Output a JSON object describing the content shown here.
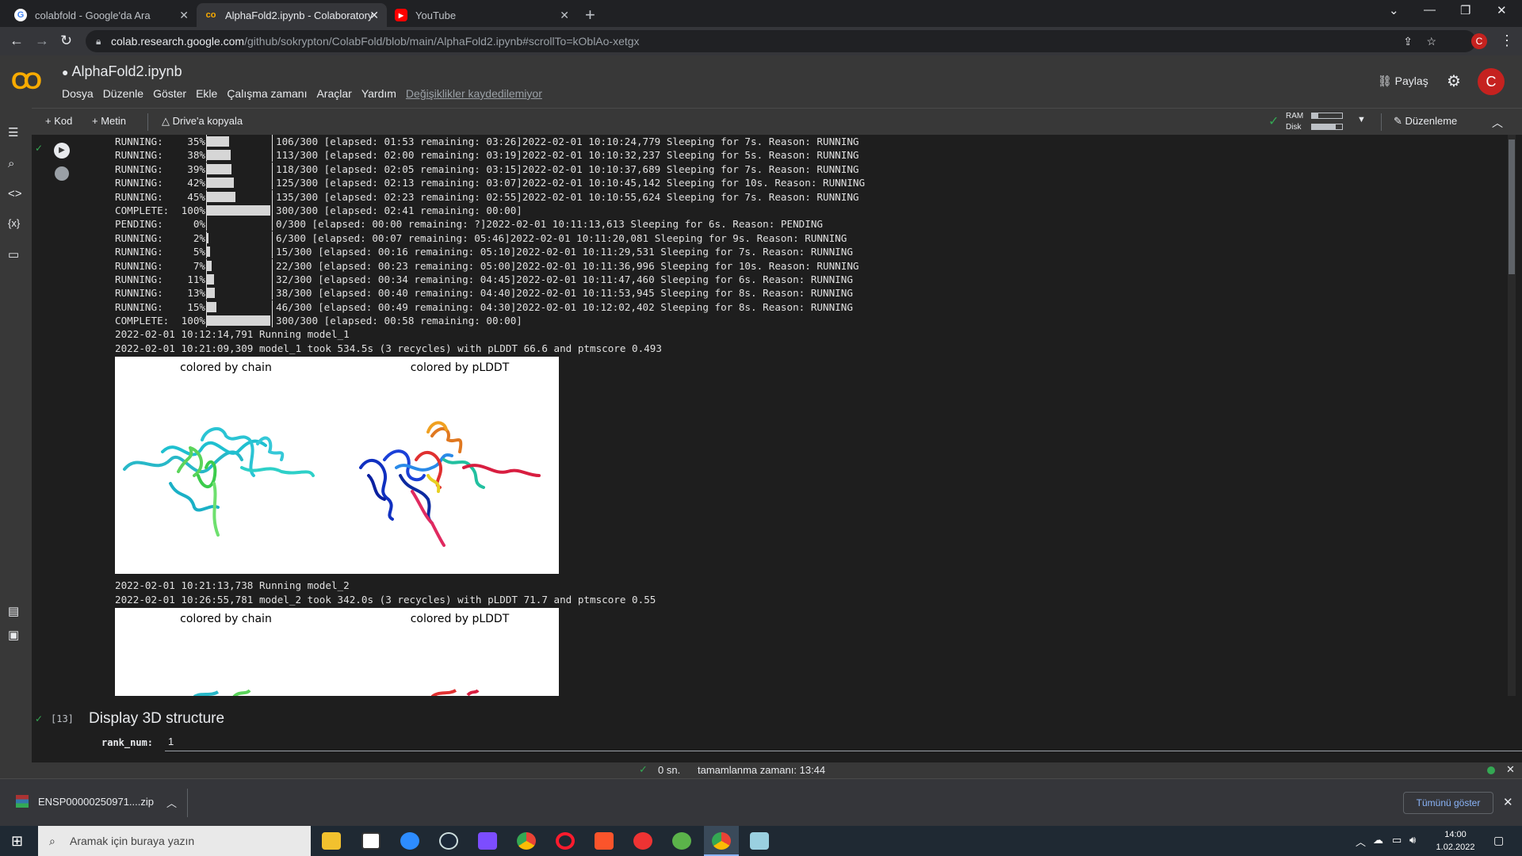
{
  "browser": {
    "tabs": [
      {
        "title": "colabfold - Google'da Ara",
        "icon": "google-icon"
      },
      {
        "title": "AlphaFold2.ipynb - Colaboratory",
        "icon": "colab-icon"
      },
      {
        "title": "YouTube",
        "icon": "youtube-icon"
      }
    ],
    "url_host": "colab.research.google.com",
    "url_path": "/github/sokrypton/ColabFold/blob/main/AlphaFold2.ipynb#scrollTo=kOblAo-xetgx",
    "profile_initial": "C"
  },
  "colab": {
    "notebook_title": "AlphaFold2.ipynb",
    "menu": [
      "Dosya",
      "Düzenle",
      "Göster",
      "Ekle",
      "Çalışma zamanı",
      "Araçlar",
      "Yardım"
    ],
    "unsaved_notice": "Değişiklikler kaydedilemiyor",
    "share_label": "Paylaş",
    "user_initial": "C"
  },
  "toolbar": {
    "add_code": "+ Kod",
    "add_text": "+ Metin",
    "copy_to_drive": "Drive'a kopyala",
    "ram_label": "RAM",
    "disk_label": "Disk",
    "ram_usage": 0.2,
    "disk_usage": 0.8,
    "edit_label": "Düzenleme"
  },
  "output": {
    "log_lines": [
      {
        "status": "RUNNING:",
        "pct": "35%",
        "fill": 0.35,
        "counter": "106/300",
        "rest": "[elapsed: 01:53 remaining: 03:26]2022-02-01 10:10:24,779 Sleeping for 7s. Reason: RUNNING"
      },
      {
        "status": "RUNNING:",
        "pct": "38%",
        "fill": 0.38,
        "counter": "113/300",
        "rest": "[elapsed: 02:00 remaining: 03:19]2022-02-01 10:10:32,237 Sleeping for 5s. Reason: RUNNING"
      },
      {
        "status": "RUNNING:",
        "pct": "39%",
        "fill": 0.39,
        "counter": "118/300",
        "rest": "[elapsed: 02:05 remaining: 03:15]2022-02-01 10:10:37,689 Sleeping for 7s. Reason: RUNNING"
      },
      {
        "status": "RUNNING:",
        "pct": "42%",
        "fill": 0.42,
        "counter": "125/300",
        "rest": "[elapsed: 02:13 remaining: 03:07]2022-02-01 10:10:45,142 Sleeping for 10s. Reason: RUNNING"
      },
      {
        "status": "RUNNING:",
        "pct": "45%",
        "fill": 0.45,
        "counter": "135/300",
        "rest": "[elapsed: 02:23 remaining: 02:55]2022-02-01 10:10:55,624 Sleeping for 7s. Reason: RUNNING"
      },
      {
        "status": "COMPLETE:",
        "pct": "100%",
        "fill": 1.0,
        "counter": "300/300",
        "rest": "[elapsed: 02:41 remaining: 00:00]"
      },
      {
        "status": "PENDING:",
        "pct": "0%",
        "fill": 0.0,
        "counter": "0/300",
        "rest": "[elapsed: 00:00 remaining: ?]2022-02-01 10:11:13,613 Sleeping for 6s. Reason: PENDING"
      },
      {
        "status": "RUNNING:",
        "pct": "2%",
        "fill": 0.02,
        "counter": "6/300",
        "rest": "[elapsed: 00:07 remaining: 05:46]2022-02-01 10:11:20,081 Sleeping for 9s. Reason: RUNNING"
      },
      {
        "status": "RUNNING:",
        "pct": "5%",
        "fill": 0.05,
        "counter": "15/300",
        "rest": "[elapsed: 00:16 remaining: 05:10]2022-02-01 10:11:29,531 Sleeping for 7s. Reason: RUNNING"
      },
      {
        "status": "RUNNING:",
        "pct": "7%",
        "fill": 0.07,
        "counter": "22/300",
        "rest": "[elapsed: 00:23 remaining: 05:00]2022-02-01 10:11:36,996 Sleeping for 10s. Reason: RUNNING"
      },
      {
        "status": "RUNNING:",
        "pct": "11%",
        "fill": 0.11,
        "counter": "32/300",
        "rest": "[elapsed: 00:34 remaining: 04:45]2022-02-01 10:11:47,460 Sleeping for 6s. Reason: RUNNING"
      },
      {
        "status": "RUNNING:",
        "pct": "13%",
        "fill": 0.13,
        "counter": "38/300",
        "rest": "[elapsed: 00:40 remaining: 04:40]2022-02-01 10:11:53,945 Sleeping for 8s. Reason: RUNNING"
      },
      {
        "status": "RUNNING:",
        "pct": "15%",
        "fill": 0.15,
        "counter": "46/300",
        "rest": "[elapsed: 00:49 remaining: 04:30]2022-02-01 10:12:02,402 Sleeping for 8s. Reason: RUNNING"
      },
      {
        "status": "COMPLETE:",
        "pct": "100%",
        "fill": 1.0,
        "counter": "300/300",
        "rest": "[elapsed: 00:58 remaining: 00:00]"
      }
    ],
    "model1_running": "2022-02-01 10:12:14,791 Running model_1",
    "model1_result": "2022-02-01 10:21:09,309 model_1 took 534.5s (3 recycles) with pLDDT 66.6 and ptmscore 0.493",
    "model2_running": "2022-02-01 10:21:13,738 Running model_2",
    "model2_result": "2022-02-01 10:26:55,781 model_2 took 342.0s (3 recycles) with pLDDT 71.7 and ptmscore 0.55",
    "plot_title_chain": "colored by chain",
    "plot_title_plddt": "colored by pLDDT"
  },
  "next_cell": {
    "exec_count": "[13]",
    "title": "Display 3D structure",
    "param_label": "rank_num:",
    "param_value": "1"
  },
  "status": {
    "duration": "0 sn.",
    "completion": "tamamlanma zamanı: 13:44"
  },
  "download": {
    "filename": "ENSP00000250971....zip",
    "show_all": "Tümünü göster"
  },
  "taskbar": {
    "search_placeholder": "Aramak için buraya yazın",
    "time": "14:00",
    "date": "1.02.2022"
  },
  "colors": {
    "accent_orange": "#f9ab00",
    "success_green": "#34a853",
    "avatar_red": "#c5221f"
  }
}
